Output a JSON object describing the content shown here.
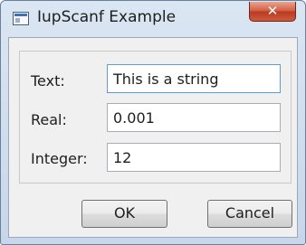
{
  "window": {
    "title": "IupScanf Example",
    "close_symbol": "✕",
    "app_icon": "window-app-icon",
    "close_icon": "close-icon"
  },
  "form": {
    "fields": [
      {
        "label": "Text:",
        "value": "This is a string"
      },
      {
        "label": "Real:",
        "value": "0.001"
      },
      {
        "label": "Integer:",
        "value": "12"
      }
    ]
  },
  "buttons": {
    "ok_label": "OK",
    "cancel_label": "Cancel"
  },
  "colors": {
    "focus_border": "#5f9bd4",
    "close_button": "#c94a2e",
    "dialog_background": "#f0f0f0"
  }
}
